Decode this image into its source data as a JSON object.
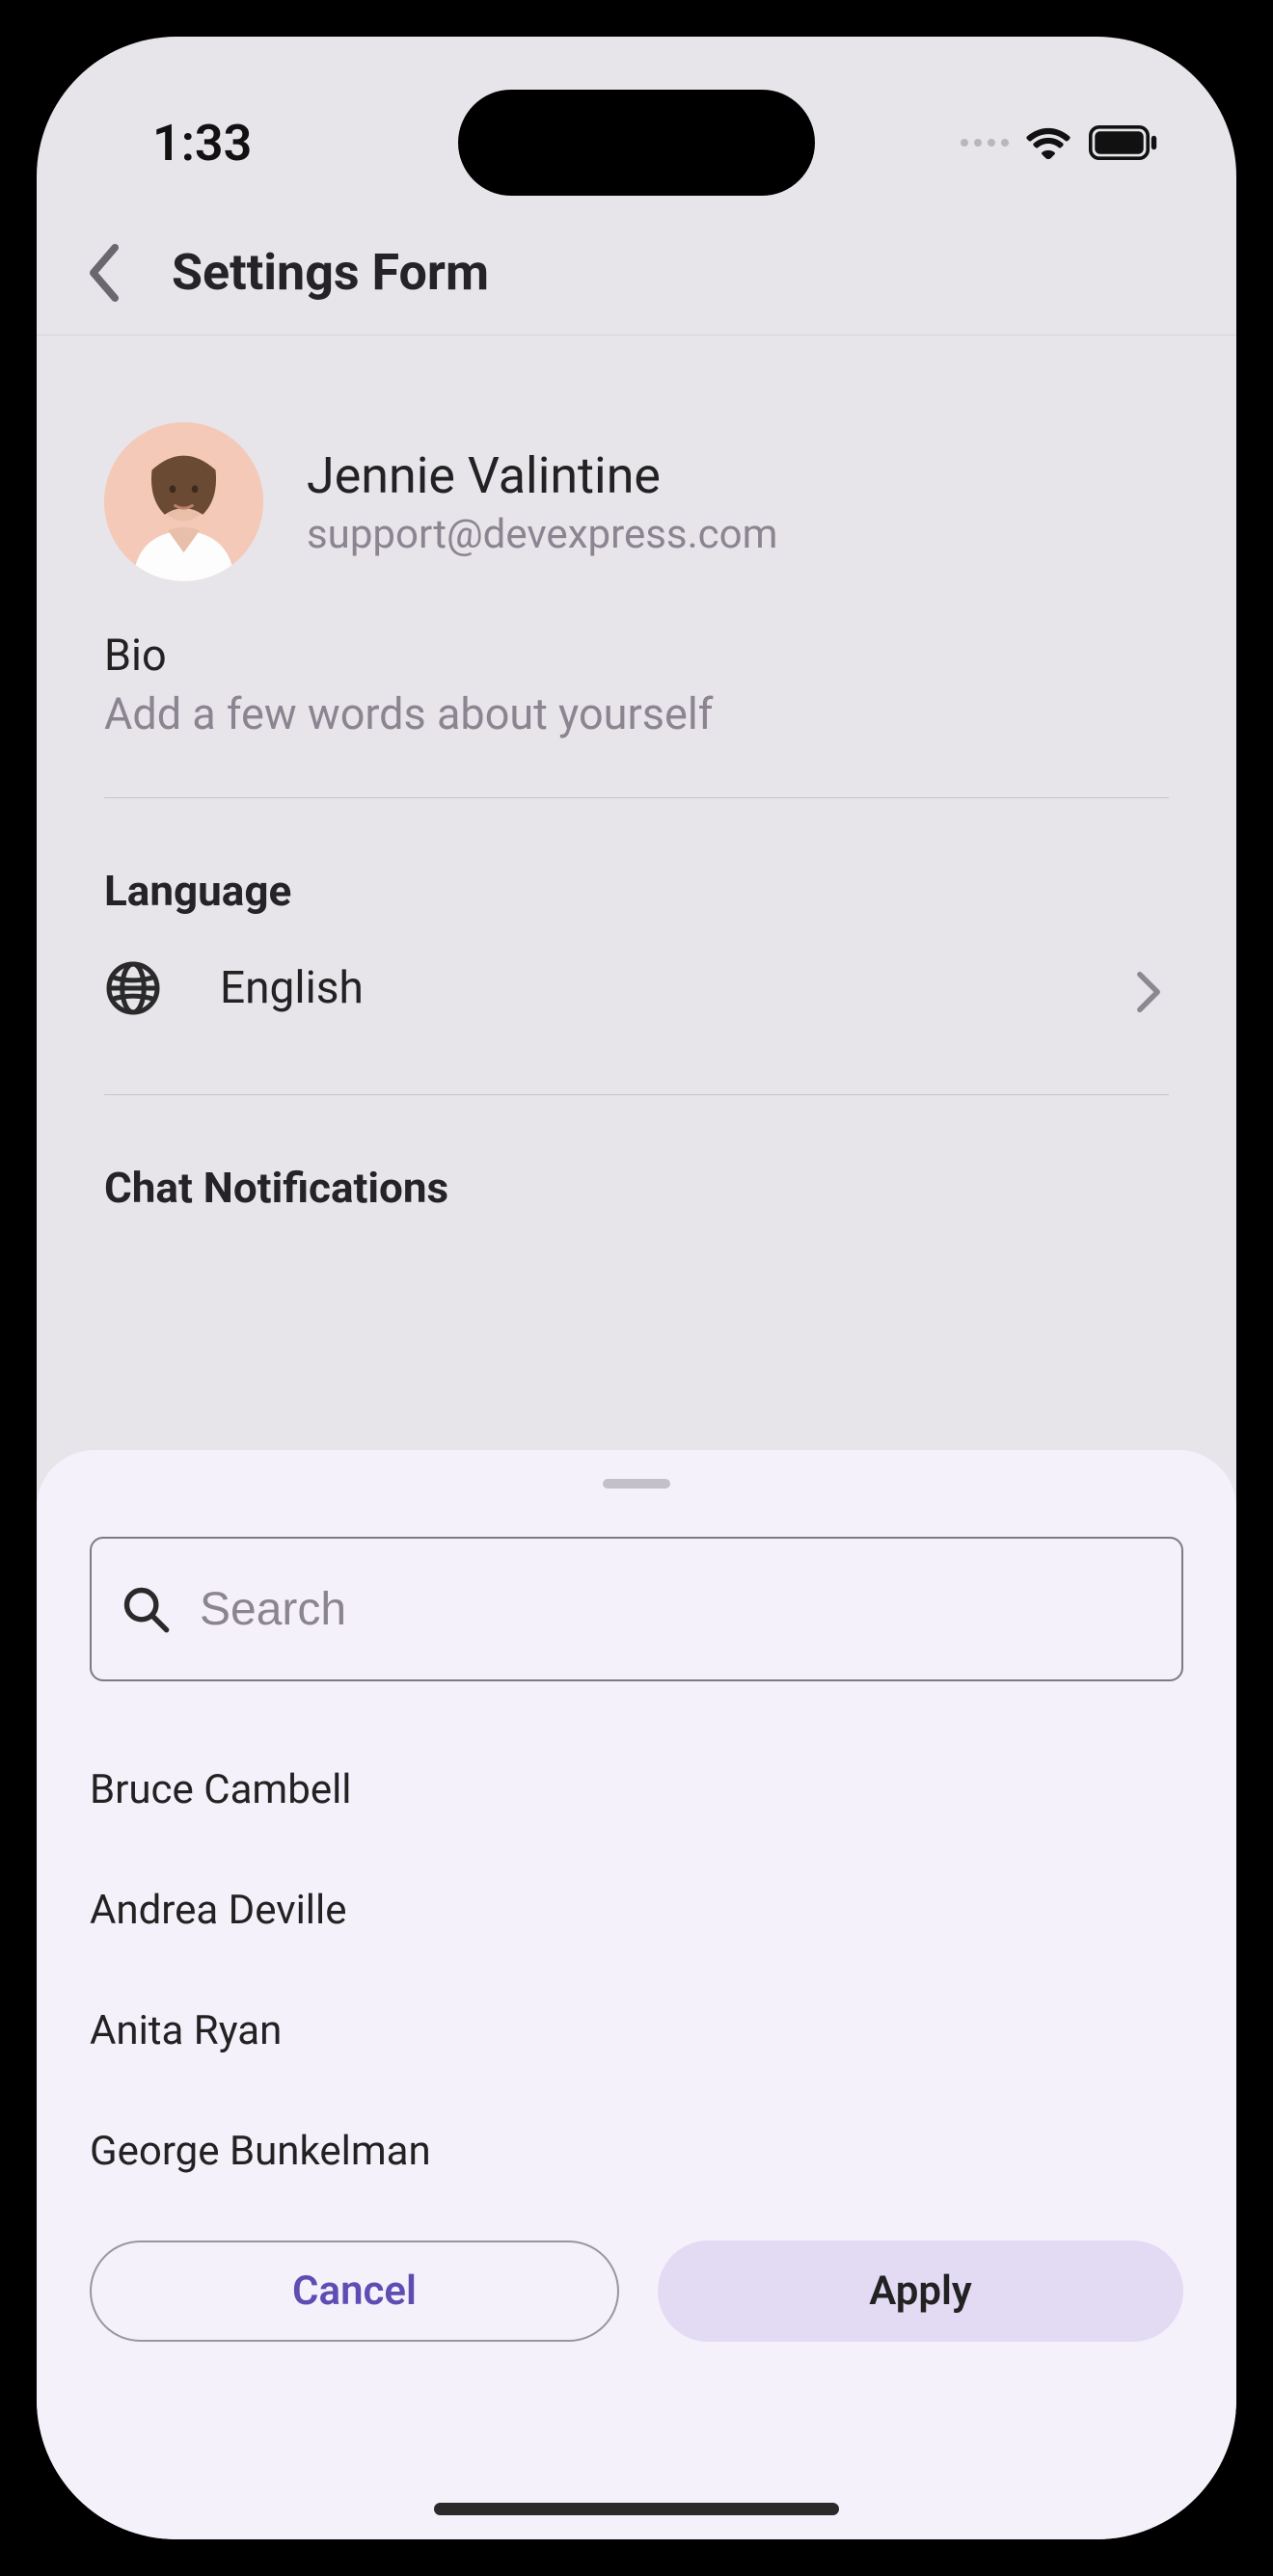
{
  "status": {
    "time": "1:33"
  },
  "nav": {
    "title": "Settings Form"
  },
  "profile": {
    "name": "Jennie Valintine",
    "email": "support@devexpress.com"
  },
  "bio": {
    "label": "Bio",
    "placeholder": "Add a few words about yourself"
  },
  "language": {
    "header": "Language",
    "value": "English"
  },
  "chat": {
    "header": "Chat Notifications"
  },
  "sheet": {
    "search_placeholder": "Search",
    "items": [
      "Bruce Cambell",
      "Andrea Deville",
      "Anita Ryan",
      "George Bunkelman"
    ],
    "cancel": "Cancel",
    "apply": "Apply"
  }
}
